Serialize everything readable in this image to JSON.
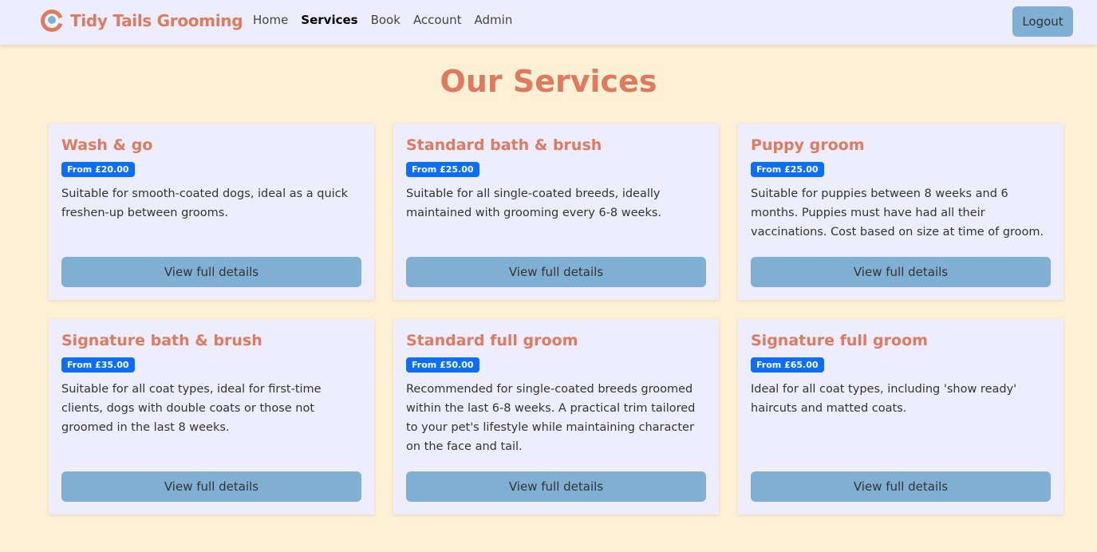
{
  "nav": {
    "brand": "Tidy Tails Grooming",
    "brand_icon": "paw-logo-icon",
    "links": [
      {
        "label": "Home",
        "active": false
      },
      {
        "label": "Services",
        "active": true
      },
      {
        "label": "Book",
        "active": false
      },
      {
        "label": "Account",
        "active": false
      },
      {
        "label": "Admin",
        "active": false
      }
    ],
    "logout_label": "Logout"
  },
  "page": {
    "title": "Our Services"
  },
  "services": [
    {
      "title": "Wash & go",
      "price": "From £20.00",
      "description": "Suitable for smooth-coated dogs, ideal as a quick freshen-up between grooms.",
      "button": "View full details"
    },
    {
      "title": "Standard bath & brush",
      "price": "From £25.00",
      "description": "Suitable for all single-coated breeds, ideally maintained with grooming every 6-8 weeks.",
      "button": "View full details"
    },
    {
      "title": "Puppy groom",
      "price": "From £25.00",
      "description": "Suitable for puppies between 8 weeks and 6 months. Puppies must have had all their vaccinations. Cost based on size at time of groom.",
      "button": "View full details"
    },
    {
      "title": "Signature bath & brush",
      "price": "From £35.00",
      "description": "Suitable for all coat types, ideal for first-time clients, dogs with double coats or those not groomed in the last 8 weeks.",
      "button": "View full details"
    },
    {
      "title": "Standard full groom",
      "price": "From £50.00",
      "description": "Recommended for single-coated breeds groomed within the last 6-8 weeks. A practical trim tailored to your pet's lifestyle while maintaining character on the face and tail.",
      "button": "View full details"
    },
    {
      "title": "Signature full groom",
      "price": "From £65.00",
      "description": "Ideal for all coat types, including 'show ready' haircuts and matted coats.",
      "button": "View full details"
    }
  ],
  "colors": {
    "background": "#fdf0d5",
    "navbar": "#eeedfd",
    "accent": "#e07a5f",
    "button": "#7fb0d4",
    "badge": "#0d6efd"
  }
}
